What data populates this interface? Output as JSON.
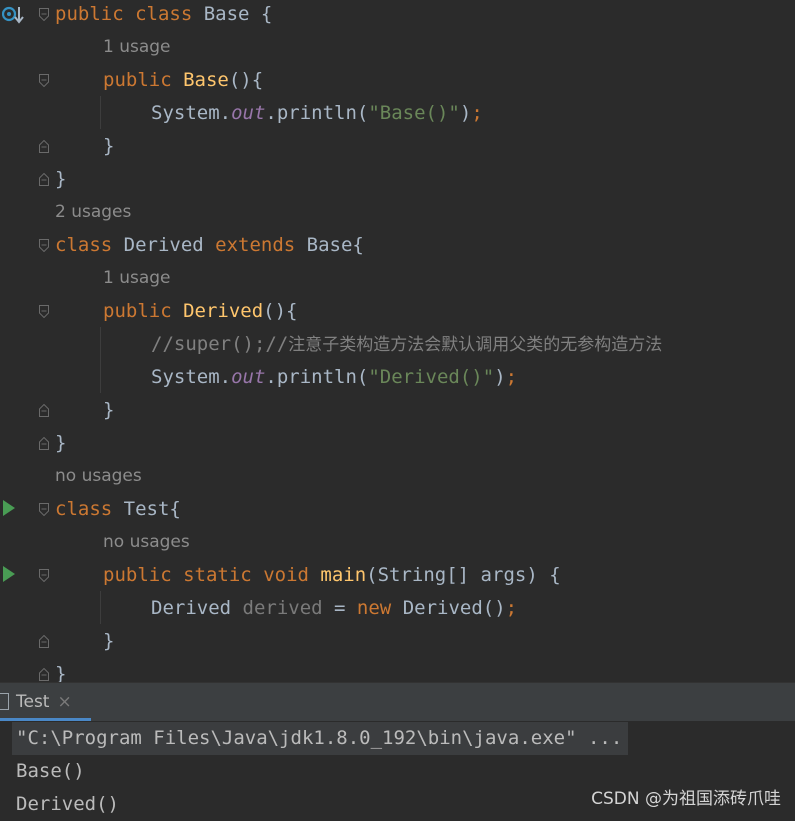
{
  "editor": {
    "hints": {
      "base_ctor": "1 usage",
      "derived_class": "2 usages",
      "derived_ctor": "1 usage",
      "test_class": "no usages",
      "main_method": "no usages"
    },
    "code": {
      "l1_public": "public",
      "l1_class": "class",
      "l1_rest": " Base {",
      "l2_public": "public",
      "l2_name": "Base",
      "l2_rest": "(){",
      "l3_sys": "System.",
      "l3_out": "out",
      "l3_println": ".println(",
      "l3_str": "\"Base()\"",
      "l3_end": ")",
      "l3_semi": ";",
      "l4": "}",
      "l5": "}",
      "l6_class": "class",
      "l6_name": " Derived ",
      "l6_extends": "extends",
      "l6_rest": " Base{",
      "l7_public": "public",
      "l7_name": "Derived",
      "l7_rest": "(){",
      "l8_comment": "//super();//",
      "l8_comment_cjk": "注意子类构造方法会默认调用父类的无参构造方法",
      "l9_sys": "System.",
      "l9_out": "out",
      "l9_println": ".println(",
      "l9_str": "\"Derived()\"",
      "l9_end": ")",
      "l9_semi": ";",
      "l10": "}",
      "l11": "}",
      "l12_class": "class",
      "l12_rest": " Test{",
      "l13_public": "public",
      "l13_static": "static",
      "l13_void": "void",
      "l13_name": "main",
      "l13_rest": "(String[] args) {",
      "l14_type": "Derived ",
      "l14_var": "derived",
      "l14_eq": " = ",
      "l14_new": "new",
      "l14_ctor": " Derived()",
      "l14_semi": ";",
      "l15": "}",
      "l16": "}"
    }
  },
  "tool_window": {
    "tab_label": "Test",
    "tab_close": "×"
  },
  "console": {
    "command": "\"C:\\Program Files\\Java\\jdk1.8.0_192\\bin\\java.exe\" ...",
    "output": [
      "Base()",
      "Derived()"
    ]
  },
  "watermark": "CSDN @为祖国添砖爪哇",
  "colors": {
    "background": "#2b2b2b",
    "keyword": "#cc7832",
    "function": "#ffc66d",
    "string": "#6a8759",
    "field": "#9876aa",
    "comment": "#808080",
    "run_icon": "#499c54",
    "tab_accent": "#4a88c7"
  },
  "icons": {
    "base_class_gutter": "implemented-override-icon",
    "run": "run-icon",
    "fold": "fold-icon",
    "tab": "console-tab-icon"
  }
}
